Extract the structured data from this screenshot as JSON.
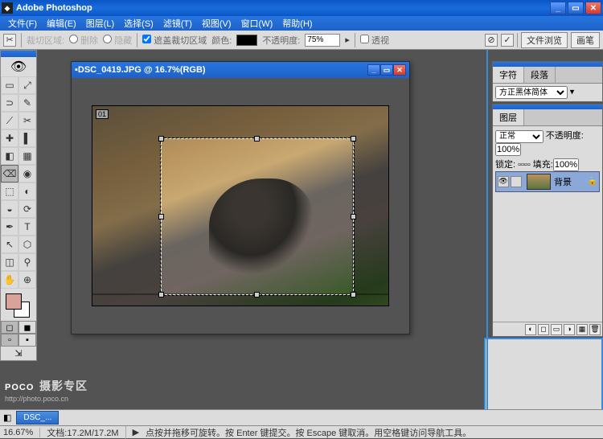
{
  "app": {
    "title": "Adobe Photoshop"
  },
  "menu": [
    "文件(F)",
    "编辑(E)",
    "图层(L)",
    "选择(S)",
    "滤镜(T)",
    "视图(V)",
    "窗口(W)",
    "帮助(H)"
  ],
  "options": {
    "crop_area_label": "裁切区域:",
    "delete": "删除",
    "hide": "隐藏",
    "shield_label": "遮盖裁切区域",
    "color_label": "颜色:",
    "opacity_label": "不透明度:",
    "opacity_value": "75%",
    "perspective_label": "透视",
    "tab1": "文件浏览",
    "tab2": "画笔"
  },
  "image_window": {
    "title": "DSC_0419.JPG @ 16.7%(RGB)",
    "tag": "01"
  },
  "char_panel": {
    "tab1": "字符",
    "tab2": "段落",
    "font": "方正黑体简体"
  },
  "layers_panel": {
    "tab": "图层",
    "mode": "正常",
    "opacity_label": "不透明度:",
    "opacity": "100%",
    "lock_label": "锁定:",
    "fill_label": "填充:",
    "fill": "100%",
    "layer_name": "背景"
  },
  "watermark": {
    "brand": "POCO",
    "sub": "摄影专区",
    "url": "http://photo.poco.cn"
  },
  "docbar": {
    "doc": "DSC_..."
  },
  "status": {
    "zoom": "16.67%",
    "doc": "文档:17.2M/17.2M",
    "hint": "点按并拖移可旋转。按 Enter 键提交。按 Escape 键取消。用空格键访问导航工具。"
  },
  "tools": [
    "▭",
    "⤢",
    "⊃",
    "✎",
    "⟋",
    "✂",
    "✚",
    "▌",
    "◧",
    "▦",
    "⌫",
    "◉",
    "⬚",
    "◐",
    "◒",
    "⟳",
    "✒",
    "T",
    "↖",
    "⬡",
    "◫",
    "⚲",
    "✋",
    "⊕"
  ]
}
